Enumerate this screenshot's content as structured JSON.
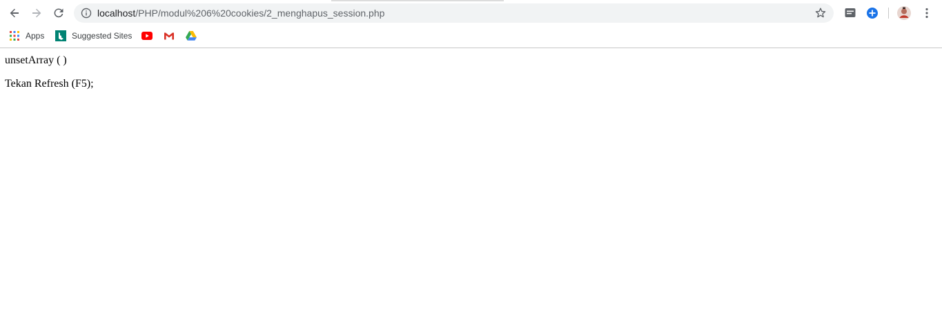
{
  "browser": {
    "url_host": "localhost",
    "url_path": "/PHP/modul%206%20cookies/2_menghapus_session.php",
    "bookmarks": {
      "apps_label": "Apps",
      "suggested_label": "Suggested Sites"
    },
    "icons": [
      "back-icon",
      "forward-icon",
      "reload-icon",
      "info-icon",
      "star-icon",
      "chat-extension-icon",
      "plus-extension-icon",
      "avatar",
      "more-icon",
      "apps-icon",
      "bing-icon",
      "youtube-icon",
      "gmail-icon",
      "drive-icon"
    ],
    "colors": {
      "omnibox_bg": "#f1f3f4",
      "youtube": "#ff0000",
      "gmail": "#d93025",
      "bing": "#008373",
      "blue": "#1a73e8"
    }
  },
  "page": {
    "line1": "unsetArray ( )",
    "line2": "Tekan Refresh (F5);"
  }
}
